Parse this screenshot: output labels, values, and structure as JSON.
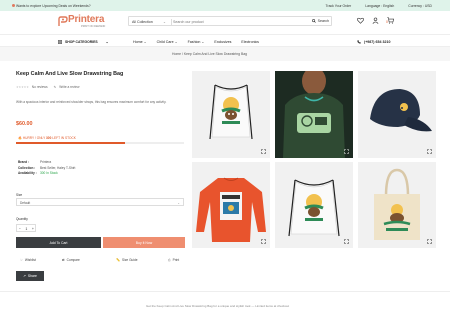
{
  "topbar": {
    "promo": "Wants to explore Upcoming Deals on Weekends?",
    "track": "Track Your Order",
    "language": "Language : English",
    "currency": "Currency : USD"
  },
  "brand": {
    "name": "Printera",
    "tagline": "PRINT ON DEMAND"
  },
  "search": {
    "category": "All Collection",
    "placeholder": "Search our product",
    "button": "Search"
  },
  "header": {
    "cart_count": "0"
  },
  "nav": {
    "shop_categories": "SHOP CATEGORIES",
    "items": [
      "Home",
      "Child Care",
      "Fashion",
      "Exclusives",
      "Electronics"
    ],
    "phone": "(+987) 654 3210"
  },
  "breadcrumb": "Home / Keep Calm And Live Slow Drawstring Bag",
  "product": {
    "title": "Keep Calm And Live Slow Drawstring Bag",
    "reviews": "No reviews",
    "write_review": "Write a review",
    "description": "With a spacious interior and reinforced shoulder straps, this bag ensures maximum comfort for any activity.",
    "price": "$60.00",
    "stock_prefix": "HURRY ! ONLY",
    "stock_count": "300",
    "stock_suffix": "LEFT IN STOCK",
    "stock_level": 0.65,
    "meta": [
      {
        "key": "Brand :",
        "value": "Printera",
        "green": false
      },
      {
        "key": "Collection :",
        "value": "Best Seller, Haley T-Shirt",
        "green": false
      },
      {
        "key": "Availability :",
        "value": "300 In Stock",
        "green": true
      }
    ],
    "size_label": "Size",
    "size_value": "Default",
    "quantity_label": "Quantity",
    "quantity": "1",
    "add_to_cart": "Add To Cart",
    "buy_now": "Buy It Now",
    "actions": [
      "Wishlist",
      "Compare",
      "Size Guide",
      "Print"
    ],
    "share": "Share"
  },
  "footer": {
    "text": "Get the Keep Calm And Live Slow Drawstring Bag for a unique and stylish look — Limited items at checkout"
  },
  "colors": {
    "accent": "#e05a2a",
    "brand": "#e0795a",
    "topbar": "#dff3ea",
    "dark_button": "#3a3d40",
    "buy_button": "#ef8e70"
  }
}
